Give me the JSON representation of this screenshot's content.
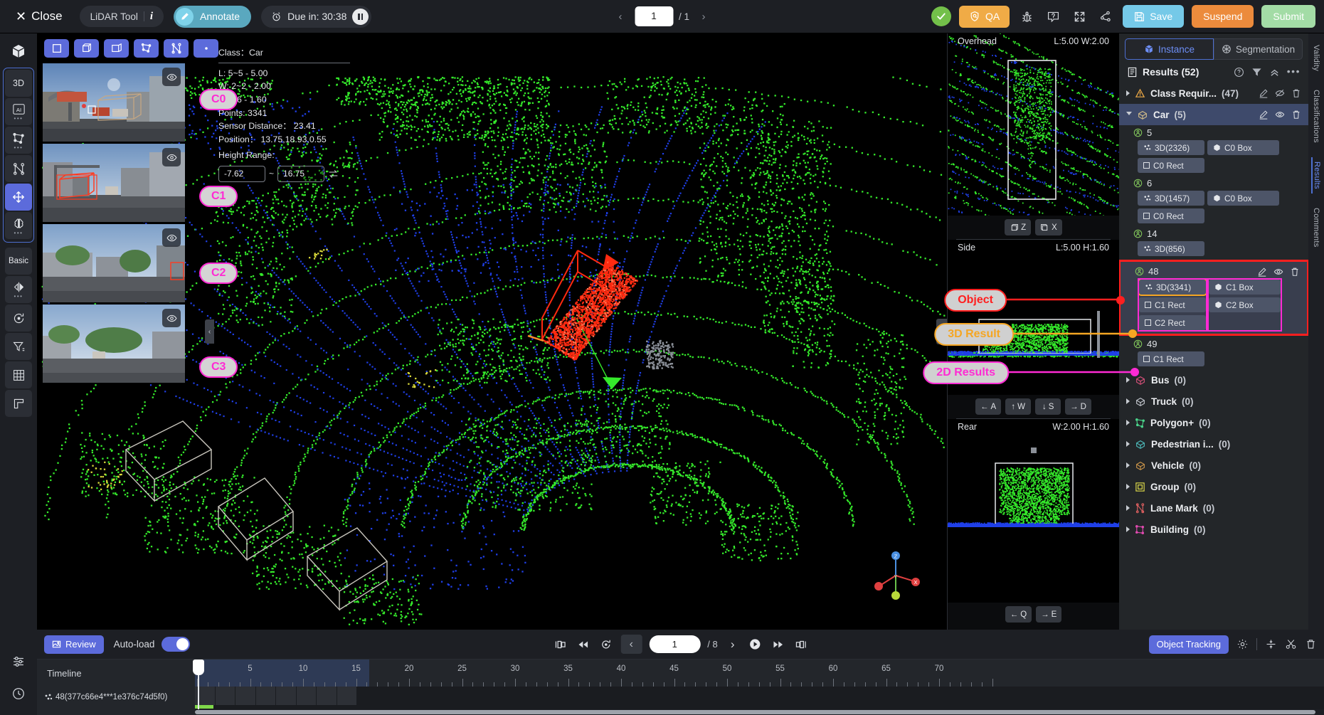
{
  "topbar": {
    "close_label": "Close",
    "tool_name": "LiDAR Tool",
    "info_glyph": "i",
    "annotate_label": "Annotate",
    "due_label": "Due in: 30:38",
    "page_current": "1",
    "page_total": "/ 1",
    "qa_label": "QA",
    "save_label": "Save",
    "suspend_label": "Suspend",
    "submit_label": "Submit",
    "icons": [
      "check-icon",
      "shield-qa-icon",
      "bug-icon",
      "help-icon",
      "fullscreen-icon",
      "share-icon"
    ]
  },
  "left_toolbar": {
    "cube_icon": "cube-icon",
    "items": [
      {
        "label": "3D",
        "name": "tool-3d"
      },
      {
        "label": "AI",
        "name": "tool-ai"
      },
      {
        "label": "",
        "name": "tool-polygon"
      },
      {
        "label": "",
        "name": "tool-lane"
      },
      {
        "label": "",
        "name": "tool-move"
      },
      {
        "label": "",
        "name": "tool-brain"
      }
    ],
    "basic_label": "Basic",
    "bottom_icons": [
      "settings-icon",
      "clock-icon"
    ]
  },
  "viewport": {
    "tool_icons": [
      "rect-tool-icon",
      "cube-tool-icon",
      "box-tool-icon",
      "polygon-tool-icon",
      "lane-tool-icon",
      "point-tool-icon"
    ],
    "info": {
      "class_label": "Class：",
      "class_value": "Car",
      "length": "L:  5~5 - 5.00",
      "width": "W:  2~2 - 2.00",
      "height": "H:  1.6 - 1.60",
      "points": "Points:  3341",
      "sensor_distance": "Sensor Distance：  23.41",
      "position": "Position：  13.75,18.93,0.55",
      "height_range_label": "Height Range:",
      "height_min": "-7.62",
      "height_max": "16.75",
      "reset_icon": "reset-icon"
    },
    "camera_labels": [
      "C0",
      "C1",
      "C2",
      "C3"
    ],
    "eye_icon": "eye-icon",
    "gizmo_axes": [
      "Z",
      "Y",
      "X"
    ]
  },
  "side_views": [
    {
      "name": "Overhead",
      "dims": "L:5.00 W:2.00",
      "keys": [
        {
          "arrow": "↺",
          "key": "Z"
        },
        {
          "arrow": "↻",
          "key": "X"
        }
      ]
    },
    {
      "name": "Side",
      "dims": "L:5.00 H:1.60",
      "keys": [
        {
          "arrow": "←",
          "key": "A"
        },
        {
          "arrow": "↑",
          "key": "W"
        },
        {
          "arrow": "↓",
          "key": "S"
        },
        {
          "arrow": "→",
          "key": "D"
        }
      ]
    },
    {
      "name": "Rear",
      "dims": "W:2.00 H:1.60",
      "keys": [
        {
          "arrow": "←",
          "key": "Q"
        },
        {
          "arrow": "→",
          "key": "E"
        }
      ]
    }
  ],
  "callouts": {
    "object": "Object",
    "result_3d": "3D Result",
    "results_2d": "2D Results"
  },
  "right_panel": {
    "tab_instance": "Instance",
    "tab_segmentation": "Segmentation",
    "results_title": "Results (52)",
    "header_icons": [
      "help-icon",
      "filter-icon",
      "collapse-all-icon",
      "more-icon"
    ],
    "classes": [
      {
        "name": "Class Requir...",
        "count": "(47)",
        "icon": "warning-icon",
        "color": "#f0ab46",
        "expanded": false,
        "selected": false,
        "acts": [
          "edit-icon",
          "hidden-eye-icon",
          "trash-icon"
        ]
      },
      {
        "name": "Car",
        "count": "(5)",
        "icon": "cuboid-icon",
        "color": "#d9c28a",
        "expanded": true,
        "selected": true,
        "acts": [
          "edit-icon",
          "eye-icon",
          "trash-icon"
        ]
      },
      {
        "name": "Bus",
        "count": "(0)",
        "icon": "cuboid-icon",
        "color": "#e0537e",
        "expanded": false,
        "selected": false,
        "acts": []
      },
      {
        "name": "Truck",
        "count": "(0)",
        "icon": "cuboid-icon",
        "color": "#c9cdd4",
        "expanded": false,
        "selected": false,
        "acts": []
      },
      {
        "name": "Polygon+",
        "count": "(0)",
        "icon": "polygon-icon",
        "color": "#4ad48a",
        "expanded": false,
        "selected": false,
        "acts": []
      },
      {
        "name": "Pedestrian i...",
        "count": "(0)",
        "icon": "cuboid-icon",
        "color": "#4fc4c4",
        "expanded": false,
        "selected": false,
        "acts": []
      },
      {
        "name": "Vehicle",
        "count": "(0)",
        "icon": "cuboid-icon",
        "color": "#d39a4a",
        "expanded": false,
        "selected": false,
        "acts": []
      },
      {
        "name": "Group",
        "count": "(0)",
        "icon": "group-icon",
        "color": "#e5e14a",
        "expanded": false,
        "selected": false,
        "acts": []
      },
      {
        "name": "Lane Mark",
        "count": "(0)",
        "icon": "lane-icon",
        "color": "#e06060",
        "expanded": false,
        "selected": false,
        "acts": []
      },
      {
        "name": "Building",
        "count": "(0)",
        "icon": "building-icon",
        "color": "#e04ab0",
        "expanded": false,
        "selected": false,
        "acts": []
      }
    ],
    "instances": [
      {
        "id": "5",
        "highlighted": false,
        "chips": [
          {
            "label": "3D(2326)",
            "kind": "pcd"
          },
          {
            "label": "C0 Box",
            "kind": "box"
          },
          {
            "label": "C0 Rect",
            "kind": "rect"
          }
        ]
      },
      {
        "id": "6",
        "highlighted": false,
        "chips": [
          {
            "label": "3D(1457)",
            "kind": "pcd"
          },
          {
            "label": "C0 Box",
            "kind": "box"
          },
          {
            "label": "C0 Rect",
            "kind": "rect"
          }
        ]
      },
      {
        "id": "14",
        "highlighted": false,
        "chips": [
          {
            "label": "3D(856)",
            "kind": "pcd"
          }
        ]
      },
      {
        "id": "48",
        "highlighted": true,
        "acts": [
          "edit-icon",
          "eye-icon",
          "trash-icon"
        ],
        "chips": [
          {
            "label": "3D(3341)",
            "kind": "pcd"
          },
          {
            "label": "C1 Box",
            "kind": "box"
          },
          {
            "label": "C1 Rect",
            "kind": "rect"
          },
          {
            "label": "C2 Box",
            "kind": "box"
          },
          {
            "label": "C2 Rect",
            "kind": "rect"
          }
        ]
      },
      {
        "id": "49",
        "highlighted": false,
        "chips": [
          {
            "label": "C1 Rect",
            "kind": "rect"
          }
        ]
      }
    ],
    "side_tabs": [
      "Validity",
      "Classifications",
      "Results",
      "Comments"
    ]
  },
  "bottom": {
    "review_label": "Review",
    "autoload_label": "Auto-load",
    "frame_current": "1",
    "frame_total": "/ 8",
    "object_tracking_label": "Object Tracking",
    "timeline_label": "Timeline",
    "timeline_object": "48(377c66e4***1e376c74d5f0)",
    "ruler_ticks": [
      "5",
      "10",
      "15",
      "20",
      "25",
      "30",
      "35",
      "40",
      "45",
      "50",
      "55",
      "60",
      "65",
      "70"
    ],
    "playback_icons": [
      "skip-start-icon",
      "rewind-icon",
      "refresh-icon",
      "prev-frame-icon",
      "next-frame-icon",
      "play-icon",
      "fast-forward-icon",
      "skip-end-icon"
    ],
    "tool_icons": [
      "gear-icon",
      "split-icon",
      "scissors-icon",
      "trash-icon"
    ]
  },
  "colors": {
    "accent": "#5c6bdb",
    "qa": "#f0ab46",
    "save": "#75c9e8",
    "suspend": "#ec8b3c",
    "submit": "#a3dca6",
    "red": "#ff1f1f",
    "orange": "#f5a623",
    "magenta": "#ff2ad4",
    "pcd_green": "#7fd84a",
    "pcd_blue": "#1f3fe8"
  }
}
